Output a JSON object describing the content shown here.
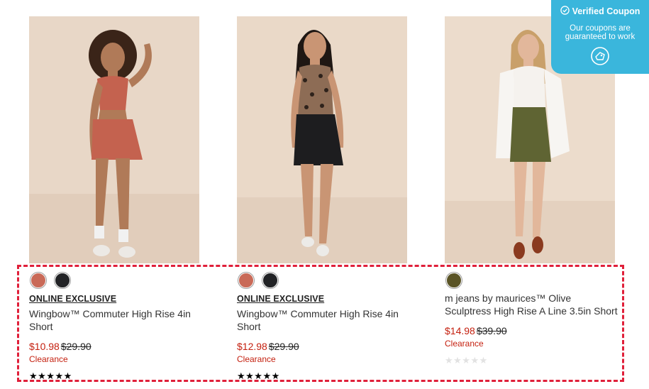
{
  "products": [
    {
      "swatches": [
        "#c96a58",
        "#222326"
      ],
      "badge": "ONLINE EXCLUSIVE",
      "title": "Wingbow™ Commuter High Rise 4in Short",
      "sale_price": "$10.98",
      "original_price": "$29.90",
      "status": "Clearance",
      "rating_stars": "★★★★★",
      "rating_filled": true
    },
    {
      "swatches": [
        "#c96a58",
        "#222326"
      ],
      "badge": "ONLINE EXCLUSIVE",
      "title": "Wingbow™ Commuter High Rise 4in Short",
      "sale_price": "$12.98",
      "original_price": "$29.90",
      "status": "Clearance",
      "rating_stars": "★★★★★",
      "rating_filled": true
    },
    {
      "swatches": [
        "#5a5426"
      ],
      "badge": "",
      "title": "m jeans by maurices™ Olive Sculptress High Rise A Line 3.5in Short",
      "sale_price": "$14.98",
      "original_price": "$39.90",
      "status": "Clearance",
      "rating_stars": "★★★★★",
      "rating_filled": false
    }
  ],
  "coupon": {
    "title": "Verified Coupon",
    "subtitle": "Our coupons are guaranteed to work",
    "icon": "coupon-badge-icon",
    "color": "#3ab6dc"
  },
  "colors": {
    "sale": "#c41f0e",
    "highlight": "#e0203a"
  }
}
